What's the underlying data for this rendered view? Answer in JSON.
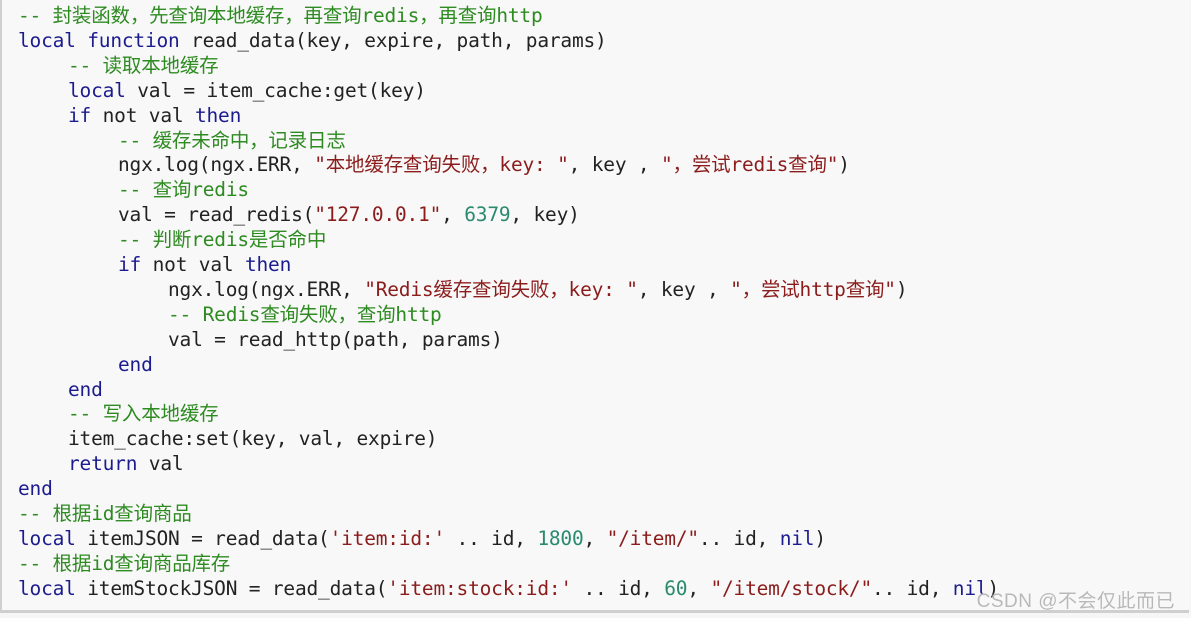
{
  "colors": {
    "keyword": "#1c1c8e",
    "comment": "#2e8b22",
    "string": "#8b1c1c",
    "number": "#2a8a6e",
    "text": "#222222",
    "background": "#f8f8f8"
  },
  "code_lines": [
    {
      "indent": 0,
      "tokens": [
        {
          "t": "cm",
          "v": "-- 封装函数，先查询本地缓存，再查询redis，再查询http"
        }
      ]
    },
    {
      "indent": 0,
      "tokens": [
        {
          "t": "kw",
          "v": "local"
        },
        {
          "t": "tx",
          "v": " "
        },
        {
          "t": "kw",
          "v": "function"
        },
        {
          "t": "tx",
          "v": " read_data(key, expire, path, params)"
        }
      ]
    },
    {
      "indent": 1,
      "tokens": [
        {
          "t": "cm",
          "v": "-- 读取本地缓存"
        }
      ]
    },
    {
      "indent": 1,
      "tokens": [
        {
          "t": "kw",
          "v": "local"
        },
        {
          "t": "tx",
          "v": " val = item_cache:get(key)"
        }
      ]
    },
    {
      "indent": 1,
      "tokens": [
        {
          "t": "kw",
          "v": "if"
        },
        {
          "t": "tx",
          "v": " not val "
        },
        {
          "t": "kw",
          "v": "then"
        }
      ]
    },
    {
      "indent": 2,
      "tokens": [
        {
          "t": "cm",
          "v": "-- 缓存未命中，记录日志"
        }
      ]
    },
    {
      "indent": 2,
      "tokens": [
        {
          "t": "tx",
          "v": "ngx.log(ngx.ERR, "
        },
        {
          "t": "st",
          "v": "\"本地缓存查询失败，key: \""
        },
        {
          "t": "tx",
          "v": ", key , "
        },
        {
          "t": "st",
          "v": "\"，尝试redis查询\""
        },
        {
          "t": "tx",
          "v": ")"
        }
      ]
    },
    {
      "indent": 2,
      "tokens": [
        {
          "t": "cm",
          "v": "-- 查询redis"
        }
      ]
    },
    {
      "indent": 2,
      "tokens": [
        {
          "t": "tx",
          "v": "val = read_redis("
        },
        {
          "t": "st",
          "v": "\"127.0.0.1\""
        },
        {
          "t": "tx",
          "v": ", "
        },
        {
          "t": "nm",
          "v": "6379"
        },
        {
          "t": "tx",
          "v": ", key)"
        }
      ]
    },
    {
      "indent": 2,
      "tokens": [
        {
          "t": "cm",
          "v": "-- 判断redis是否命中"
        }
      ]
    },
    {
      "indent": 2,
      "tokens": [
        {
          "t": "kw",
          "v": "if"
        },
        {
          "t": "tx",
          "v": " not val "
        },
        {
          "t": "kw",
          "v": "then"
        }
      ]
    },
    {
      "indent": 3,
      "tokens": [
        {
          "t": "tx",
          "v": "ngx.log(ngx.ERR, "
        },
        {
          "t": "st",
          "v": "\"Redis缓存查询失败，key: \""
        },
        {
          "t": "tx",
          "v": ", key , "
        },
        {
          "t": "st",
          "v": "\"，尝试http查询\""
        },
        {
          "t": "tx",
          "v": ")"
        }
      ]
    },
    {
      "indent": 3,
      "tokens": [
        {
          "t": "cm",
          "v": "-- Redis查询失败，查询http"
        }
      ]
    },
    {
      "indent": 3,
      "tokens": [
        {
          "t": "tx",
          "v": "val = read_http(path, params)"
        }
      ]
    },
    {
      "indent": 2,
      "tokens": [
        {
          "t": "kw",
          "v": "end"
        }
      ]
    },
    {
      "indent": 1,
      "tokens": [
        {
          "t": "kw",
          "v": "end"
        }
      ]
    },
    {
      "indent": 1,
      "tokens": [
        {
          "t": "cm",
          "v": "-- 写入本地缓存"
        }
      ]
    },
    {
      "indent": 1,
      "tokens": [
        {
          "t": "tx",
          "v": "item_cache:set(key, val, expire)"
        }
      ]
    },
    {
      "indent": 1,
      "tokens": [
        {
          "t": "kw",
          "v": "return"
        },
        {
          "t": "tx",
          "v": " val"
        }
      ]
    },
    {
      "indent": 0,
      "tokens": [
        {
          "t": "kw",
          "v": "end"
        }
      ]
    },
    {
      "indent": 0,
      "tokens": [
        {
          "t": "cm",
          "v": "-- 根据id查询商品"
        }
      ]
    },
    {
      "indent": 0,
      "tokens": [
        {
          "t": "kw",
          "v": "local"
        },
        {
          "t": "tx",
          "v": " itemJSON = read_data("
        },
        {
          "t": "st",
          "v": "'item:id:'"
        },
        {
          "t": "tx",
          "v": " .. id, "
        },
        {
          "t": "nm",
          "v": "1800"
        },
        {
          "t": "tx",
          "v": ", "
        },
        {
          "t": "st",
          "v": "\"/item/\""
        },
        {
          "t": "tx",
          "v": ".. id, "
        },
        {
          "t": "kw",
          "v": "nil"
        },
        {
          "t": "tx",
          "v": ")"
        }
      ]
    },
    {
      "indent": 0,
      "tokens": [
        {
          "t": "cm",
          "v": "-- 根据id查询商品库存"
        }
      ]
    },
    {
      "indent": 0,
      "tokens": [
        {
          "t": "kw",
          "v": "local"
        },
        {
          "t": "tx",
          "v": " itemStockJSON = read_data("
        },
        {
          "t": "st",
          "v": "'item:stock:id:'"
        },
        {
          "t": "tx",
          "v": " .. id, "
        },
        {
          "t": "nm",
          "v": "60"
        },
        {
          "t": "tx",
          "v": ", "
        },
        {
          "t": "st",
          "v": "\"/item/stock/\""
        },
        {
          "t": "tx",
          "v": ".. id, "
        },
        {
          "t": "kw",
          "v": "nil"
        },
        {
          "t": "tx",
          "v": ")"
        }
      ]
    }
  ],
  "watermark": "CSDN @不会仅此而已"
}
